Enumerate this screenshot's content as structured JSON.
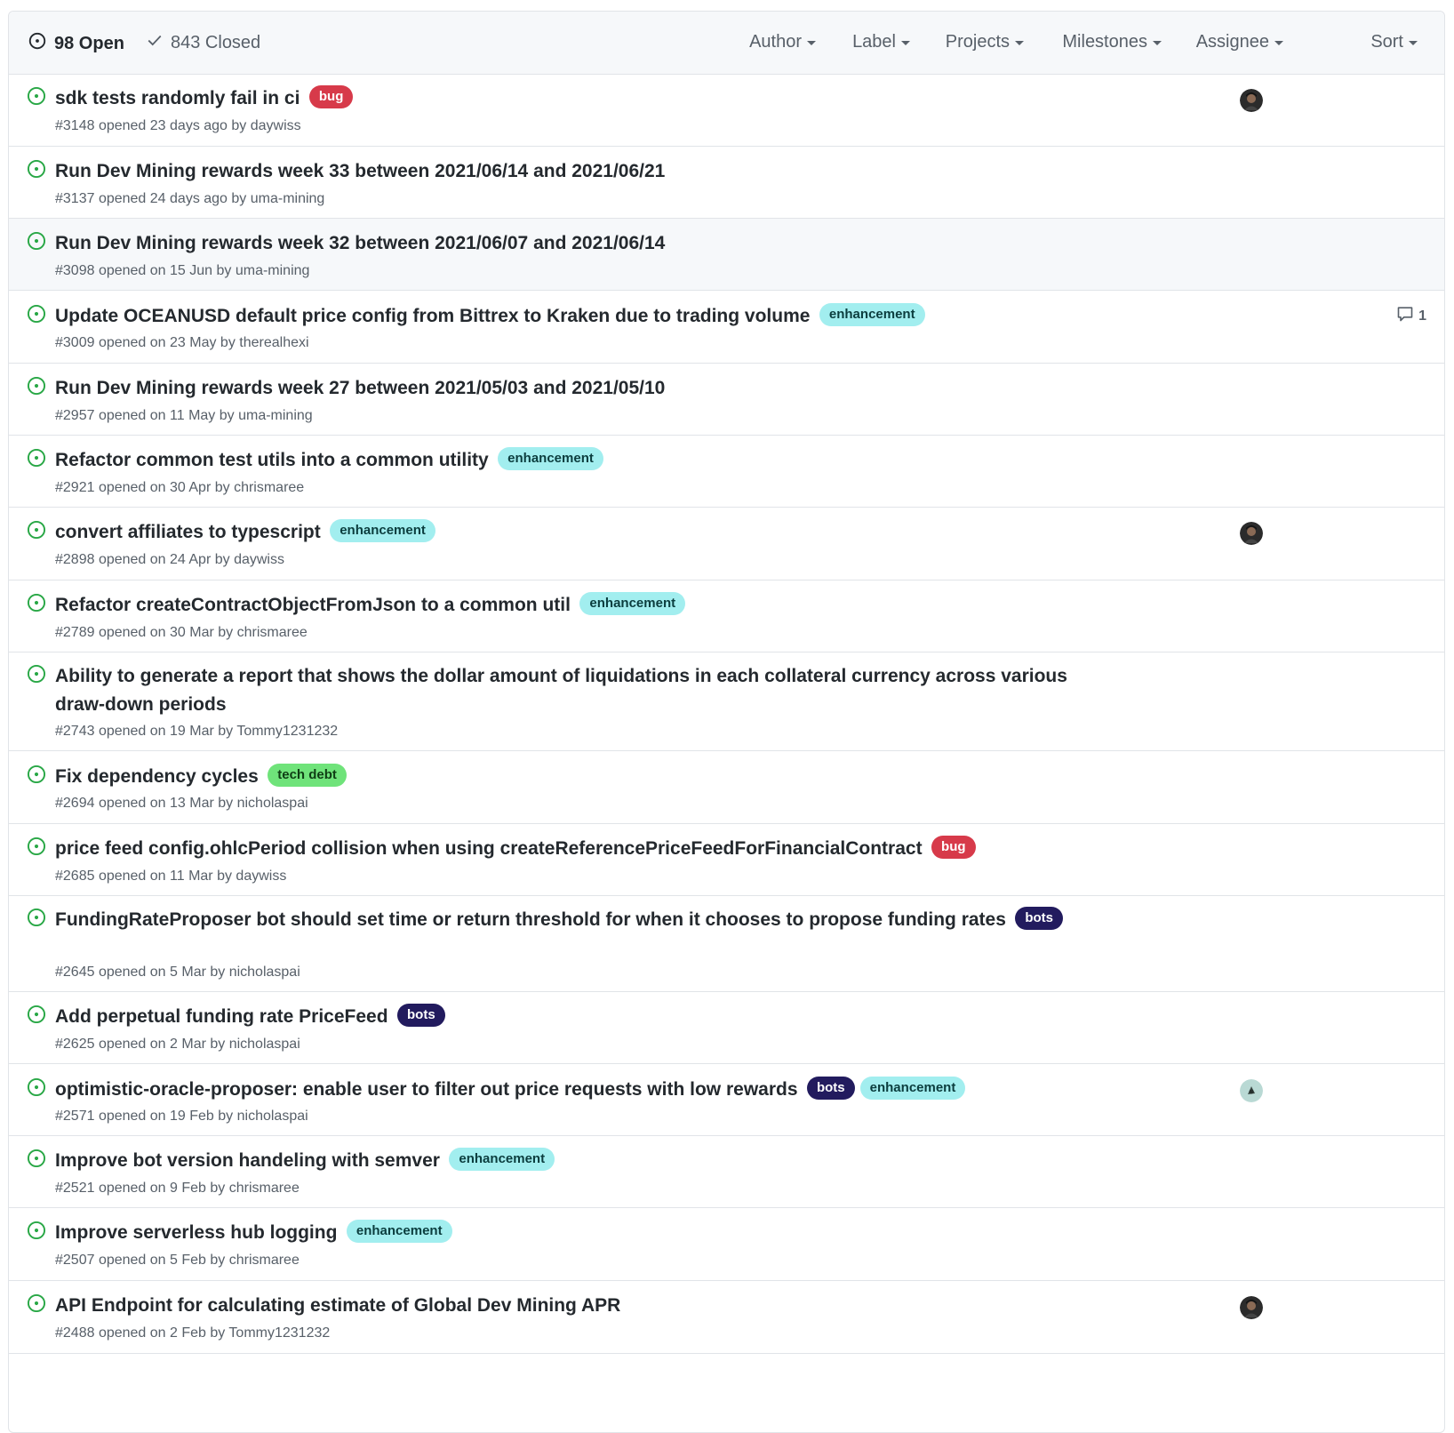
{
  "header": {
    "open_count": "98 Open",
    "closed_count": "843 Closed",
    "filters": [
      "Author",
      "Label",
      "Projects",
      "Milestones",
      "Assignee",
      "Sort"
    ]
  },
  "colors": {
    "open_icon": "#28a745",
    "bug": "#d73a4a",
    "enhancement": "#a2eeef",
    "tech_debt": "#6fe37a",
    "bots": "#221b5e"
  },
  "issues": [
    {
      "title": "sdk tests randomly fail in ci",
      "meta": "#3148 opened 23 days ago by daywiss",
      "labels": [
        "bug"
      ],
      "avatar": "dark",
      "comments": ""
    },
    {
      "title": "Run Dev Mining rewards week 33 between 2021/06/14 and 2021/06/21",
      "meta": "#3137 opened 24 days ago by uma-mining",
      "labels": [],
      "avatar": "",
      "comments": ""
    },
    {
      "title": "Run Dev Mining rewards week 32 between 2021/06/07 and 2021/06/14",
      "meta": "#3098 opened on 15 Jun by uma-mining",
      "labels": [],
      "avatar": "",
      "comments": ""
    },
    {
      "title": "Update OCEANUSD default price config from Bittrex to Kraken due to trading volume",
      "meta": "#3009 opened on 23 May by therealhexi",
      "labels": [
        "enhancement"
      ],
      "avatar": "",
      "comments": "1"
    },
    {
      "title": "Run Dev Mining rewards week 27 between 2021/05/03 and 2021/05/10",
      "meta": "#2957 opened on 11 May by uma-mining",
      "labels": [],
      "avatar": "",
      "comments": ""
    },
    {
      "title": "Refactor common test utils into a common utility",
      "meta": "#2921 opened on 30 Apr by chrismaree",
      "labels": [
        "enhancement"
      ],
      "avatar": "",
      "comments": ""
    },
    {
      "title": "convert affiliates to typescript",
      "meta": "#2898 opened on 24 Apr by daywiss",
      "labels": [
        "enhancement"
      ],
      "avatar": "dark",
      "comments": ""
    },
    {
      "title": "Refactor createContractObjectFromJson to a common util",
      "meta": "#2789 opened on 30 Mar by chrismaree",
      "labels": [
        "enhancement"
      ],
      "avatar": "",
      "comments": ""
    },
    {
      "title": "Ability to generate a report that shows the dollar amount of liquidations in each collateral currency across various draw-down periods",
      "meta": "#2743 opened on 19 Mar by Tommy1231232",
      "labels": [],
      "avatar": "",
      "comments": ""
    },
    {
      "title": "Fix dependency cycles",
      "meta": "#2694 opened on 13 Mar by nicholaspai",
      "labels": [
        "tech debt"
      ],
      "avatar": "",
      "comments": ""
    },
    {
      "title": "price feed config.ohlcPeriod collision when using createReferencePriceFeedForFinancialContract",
      "meta": "#2685 opened on 11 Mar by daywiss",
      "labels": [
        "bug"
      ],
      "avatar": "",
      "comments": ""
    },
    {
      "title": "FundingRateProposer bot should set time or return threshold for when it chooses to propose funding rates",
      "meta": "#2645 opened on 5 Mar by nicholaspai",
      "labels": [
        "bots"
      ],
      "avatar": "",
      "comments": ""
    },
    {
      "title": "Add perpetual funding rate PriceFeed",
      "meta": "#2625 opened on 2 Mar by nicholaspai",
      "labels": [
        "bots"
      ],
      "avatar": "",
      "comments": ""
    },
    {
      "title": "optimistic-oracle-proposer: enable user to filter out price requests with low rewards",
      "meta": "#2571 opened on 19 Feb by nicholaspai",
      "labels": [
        "bots",
        "enhancement"
      ],
      "avatar": "light",
      "comments": ""
    },
    {
      "title": "Improve bot version handeling with semver",
      "meta": "#2521 opened on 9 Feb by chrismaree",
      "labels": [
        "enhancement"
      ],
      "avatar": "",
      "comments": ""
    },
    {
      "title": "Improve serverless hub logging",
      "meta": "#2507 opened on 5 Feb by chrismaree",
      "labels": [
        "enhancement"
      ],
      "avatar": "",
      "comments": ""
    },
    {
      "title": "API Endpoint for calculating estimate of Global Dev Mining APR",
      "meta": "#2488 opened on 2 Feb by Tommy1231232",
      "labels": [],
      "avatar": "dark",
      "comments": ""
    }
  ]
}
